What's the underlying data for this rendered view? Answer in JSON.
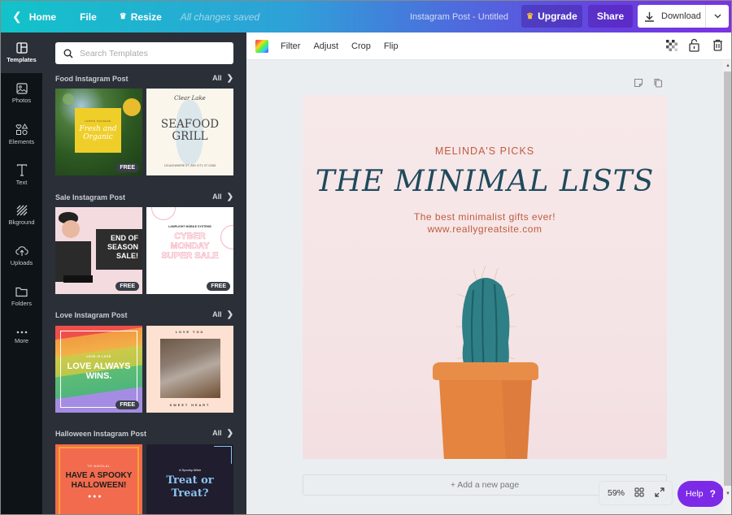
{
  "topbar": {
    "home_label": "Home",
    "file_label": "File",
    "resize_label": "Resize",
    "save_status": "All changes saved",
    "document_title": "Instagram Post - Untitled",
    "upgrade_label": "Upgrade",
    "share_label": "Share",
    "download_label": "Download"
  },
  "rail": {
    "items": [
      {
        "label": "Templates",
        "icon": "templates-icon",
        "active": true
      },
      {
        "label": "Photos",
        "icon": "photos-icon"
      },
      {
        "label": "Elements",
        "icon": "elements-icon"
      },
      {
        "label": "Text",
        "icon": "text-icon"
      },
      {
        "label": "Bkground",
        "icon": "background-icon"
      },
      {
        "label": "Uploads",
        "icon": "uploads-icon"
      },
      {
        "label": "Folders",
        "icon": "folders-icon"
      },
      {
        "label": "More",
        "icon": "more-icon"
      }
    ]
  },
  "panel": {
    "search_placeholder": "Search Templates",
    "all_label": "All",
    "free_badge": "FREE",
    "sections": [
      {
        "title": "Food Instagram Post",
        "templates": [
          {
            "name": "Fresh and Organic",
            "small": "LEMON SQUEEZE",
            "free": true
          },
          {
            "name": "SEAFOOD GRILL",
            "script": "Clear Lake",
            "small": "123 ANYWHERE ST., ANY CITY, ST 12345",
            "free": false
          }
        ]
      },
      {
        "title": "Sale Instagram Post",
        "templates": [
          {
            "name": "END OF SEASON SALE!",
            "free": true
          },
          {
            "name": "CYBER MONDAY SUPER SALE",
            "small": "LAMPLIGHT MOBILE SYSTEMS",
            "free": true
          }
        ]
      },
      {
        "title": "Love Instagram Post",
        "templates": [
          {
            "name": "LOVE ALWAYS WINS.",
            "small": "LOVE IS LOVE",
            "free": true
          },
          {
            "name": "LOVE YOU",
            "small": "SWEET HEART",
            "free": false
          }
        ]
      },
      {
        "title": "Halloween Instagram Post",
        "templates": [
          {
            "name": "HAVE A SPOOKY HALLOWEEN!",
            "small": "TO NIKOLAI,",
            "free": false
          },
          {
            "name": "Treat or Treat?",
            "small": "A Spooky Affair",
            "free": false
          }
        ]
      }
    ]
  },
  "toolbar": {
    "filter_label": "Filter",
    "adjust_label": "Adjust",
    "crop_label": "Crop",
    "flip_label": "Flip"
  },
  "design": {
    "kicker": "MELINDA'S PICKS",
    "title": "THE MINIMAL LISTS",
    "tagline": "The best minimalist gifts ever!",
    "url": "www.reallygreatsite.com"
  },
  "footer": {
    "add_page_label": "+ Add a new page",
    "zoom_level": "59%",
    "help_label": "Help",
    "help_glyph": "?"
  },
  "colors": {
    "accent": "#7d2ae8",
    "design_text_orange": "#c05c3d",
    "design_title_teal": "#1f4a5c"
  }
}
